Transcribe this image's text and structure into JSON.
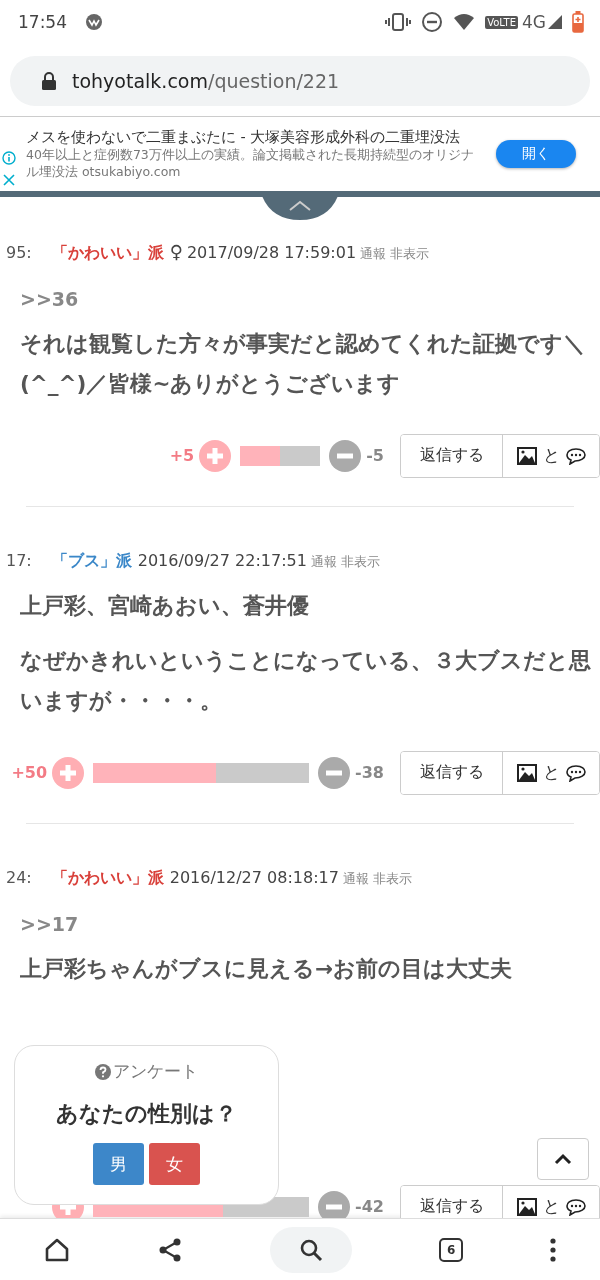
{
  "status_bar": {
    "time": "17:54",
    "volte": "VoLTE",
    "network": "4G"
  },
  "address_bar": {
    "domain": "tohyotalk.com",
    "path": "/question/221"
  },
  "ad": {
    "title": "メスを使わないで二重まぶたに - 大塚美容形成外科の二重埋没法",
    "description": "40年以上と症例数73万件以上の実績。論文掲載された長期持続型のオリジナル埋没法 otsukabiyo.com",
    "button": "開く"
  },
  "posts": [
    {
      "number": "95:",
      "faction": {
        "label": "「かわいい」派",
        "color": "#d9403a"
      },
      "gender": "♀",
      "date": "2017/09/28 17:59:01",
      "report": "通報",
      "hide": "非表示",
      "reply_to": ">>36",
      "paragraphs": [
        "それは観覧した方々が事実だと認めてくれた証拠です＼(^_^)／皆様~ありがとうございます"
      ],
      "plus": "+5",
      "minus": "-5",
      "level": 0.5,
      "reply_button": "返信する",
      "attach_text": "と"
    },
    {
      "number": "17:",
      "faction": {
        "label": "「ブス」派",
        "color": "#3a87c8"
      },
      "date": "2016/09/27 22:17:51",
      "report": "通報",
      "hide": "非表示",
      "paragraphs": [
        "上戸彩、宮崎あおい、蒼井優",
        "なぜかきれいということになっている、３大ブスだと思いますが・・・・。"
      ],
      "plus": "+50",
      "minus": "-38",
      "level": 0.57,
      "reply_button": "返信する",
      "attach_text": "と"
    },
    {
      "number": "24:",
      "faction": {
        "label": "「かわいい」派",
        "color": "#d9403a"
      },
      "date": "2016/12/27 08:18:17",
      "report": "通報",
      "hide": "非表示",
      "reply_to": ">>17",
      "paragraphs": [
        "上戸彩ちゃんがブスに見える→お前の目は大丈夫"
      ],
      "minus": "-42",
      "level": 0.6,
      "reply_button": "返信する",
      "attach_text": "と"
    }
  ],
  "poll": {
    "label": "アンケート",
    "question": "あなたの性別は？",
    "options": [
      {
        "label": "男",
        "color": "#3d87c9"
      },
      {
        "label": "女",
        "color": "#d9534f"
      }
    ]
  },
  "bottom_nav": {
    "tab_count": "6"
  }
}
